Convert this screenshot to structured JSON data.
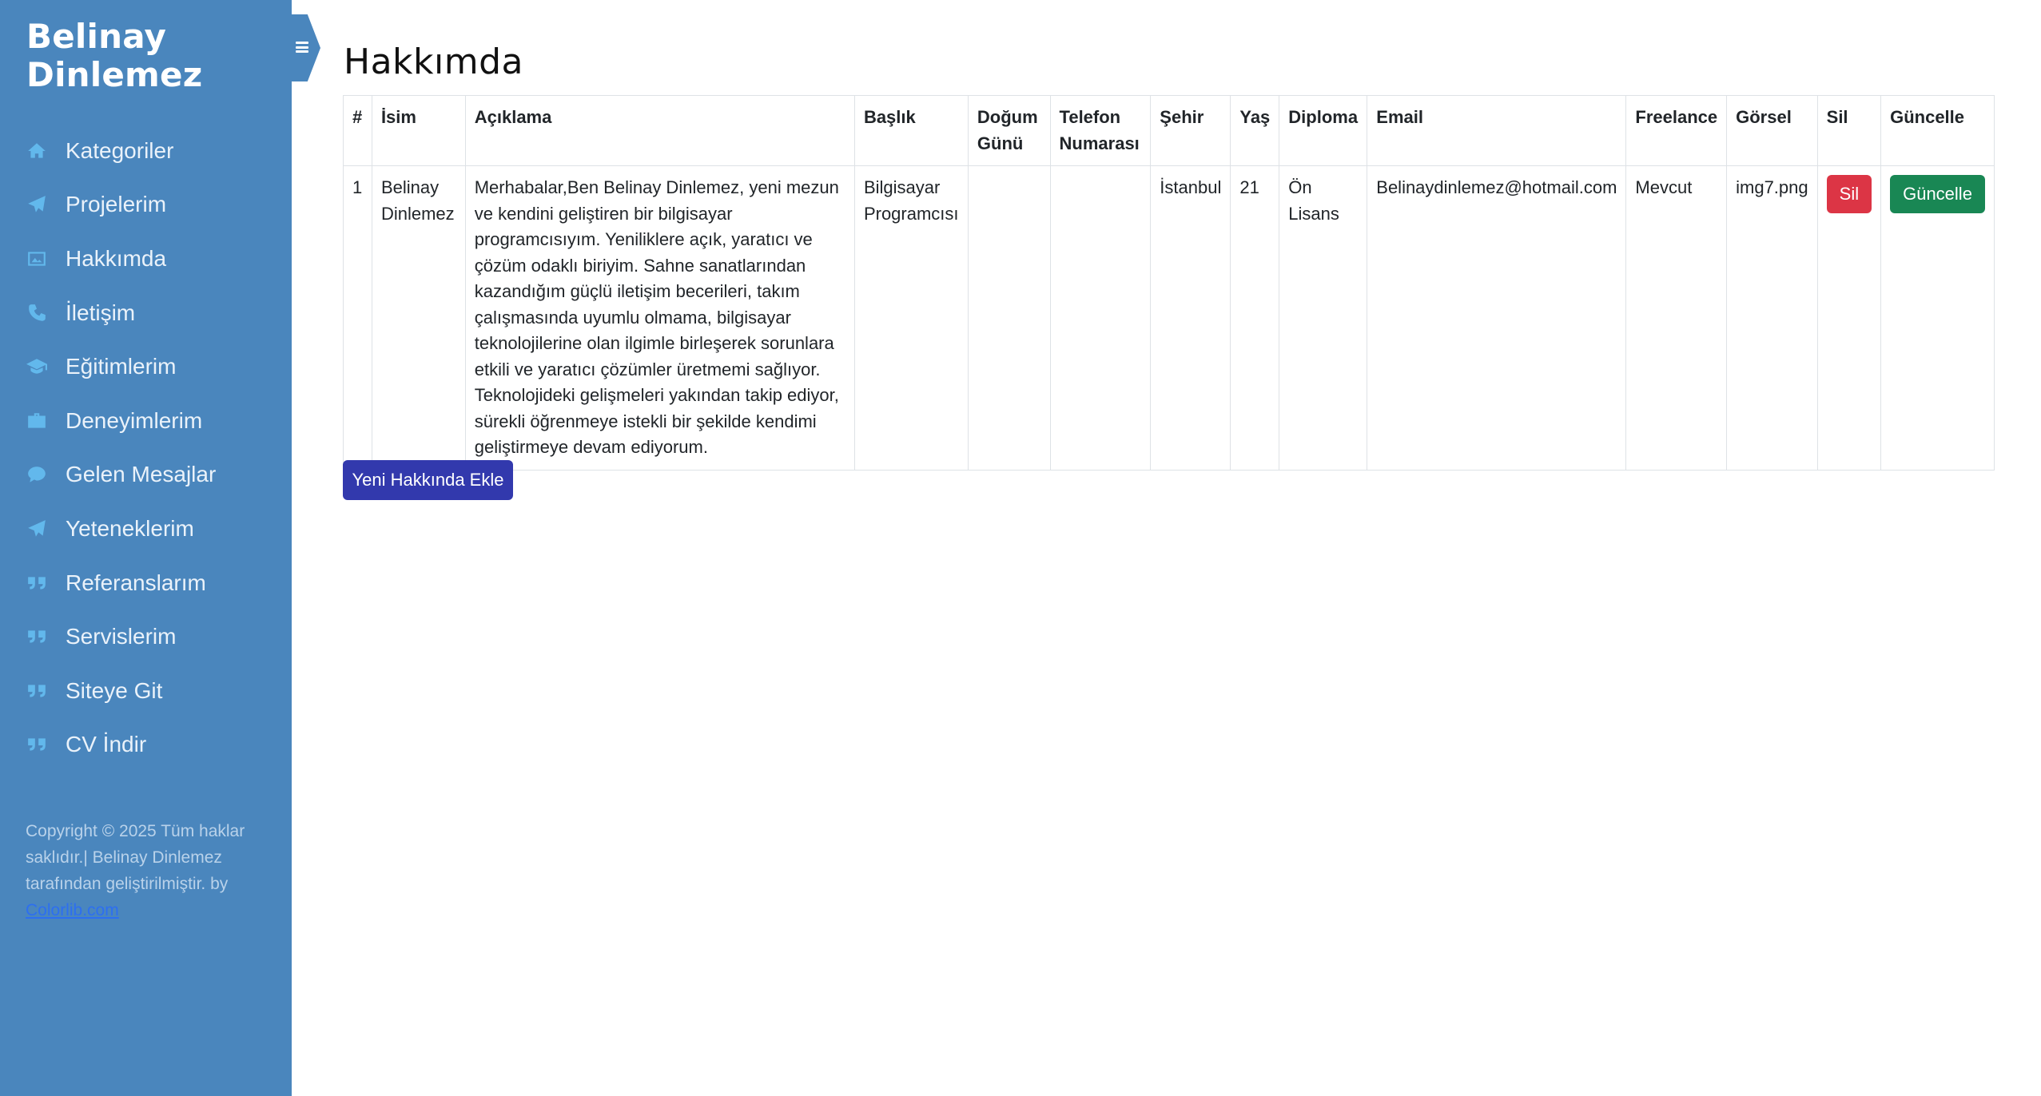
{
  "brand": {
    "line1": "Belinay",
    "line2": "Dinlemez"
  },
  "sidebar": {
    "items": [
      {
        "label": "Kategoriler",
        "icon": "home-icon"
      },
      {
        "label": "Projelerim",
        "icon": "paper-plane-icon"
      },
      {
        "label": "Hakkımda",
        "icon": "image-icon"
      },
      {
        "label": "İletişim",
        "icon": "phone-icon"
      },
      {
        "label": "Eğitimlerim",
        "icon": "graduation-cap-icon"
      },
      {
        "label": "Deneyimlerim",
        "icon": "briefcase-icon"
      },
      {
        "label": "Gelen Mesajlar",
        "icon": "comment-icon"
      },
      {
        "label": "Yeteneklerim",
        "icon": "paper-plane-icon"
      },
      {
        "label": "Referanslarım",
        "icon": "quote-icon"
      },
      {
        "label": "Servislerim",
        "icon": "quote-icon"
      },
      {
        "label": "Siteye Git",
        "icon": "quote-icon"
      },
      {
        "label": "CV İndir",
        "icon": "quote-icon"
      }
    ],
    "copyright_text": "Copyright © 2025 Tüm haklar saklıdır.| Belinay Dinlemez tarafından geliştirilmiştir. by",
    "copyright_link": "Colorlib.com"
  },
  "page": {
    "title": "Hakkımda"
  },
  "table": {
    "headers": [
      "#",
      "İsim",
      "Açıklama",
      "Başlık",
      "Doğum Günü",
      "Telefon Numarası",
      "Şehir",
      "Yaş",
      "Diploma",
      "Email",
      "Freelance",
      "Görsel",
      "Sil",
      "Güncelle"
    ],
    "row": {
      "index": "1",
      "name": "Belinay Dinlemez",
      "description": "Merhabalar,Ben Belinay Dinlemez, yeni mezun ve kendini geliştiren bir bilgisayar programcısıyım. Yeniliklere açık, yaratıcı ve çözüm odaklı biriyim. Sahne sanatlarından kazandığım güçlü iletişim becerileri, takım çalışmasında uyumlu olmama, bilgisayar teknolojilerine olan ilgimle birleşerek sorunlara etkili ve yaratıcı çözümler üretmemi sağlıyor. Teknolojideki gelişmeleri yakından takip ediyor, sürekli öğrenmeye istekli bir şekilde kendimi geliştirmeye devam ediyorum.",
      "title": "Bilgisayar Programcısı",
      "birthday": "",
      "phone": "",
      "city": "İstanbul",
      "age": "21",
      "diploma": "Ön Lisans",
      "email": "Belinaydinlemez@hotmail.com",
      "freelance": "Mevcut",
      "image": "img7.png",
      "delete_label": "Sil",
      "update_label": "Güncelle"
    }
  },
  "add_button": "Yeni Hakkında Ekle",
  "colors": {
    "sidebar_bg": "#4a86bd",
    "icon": "#62b8ec",
    "danger": "#dc3545",
    "success": "#198754",
    "primary": "#3239ad"
  }
}
